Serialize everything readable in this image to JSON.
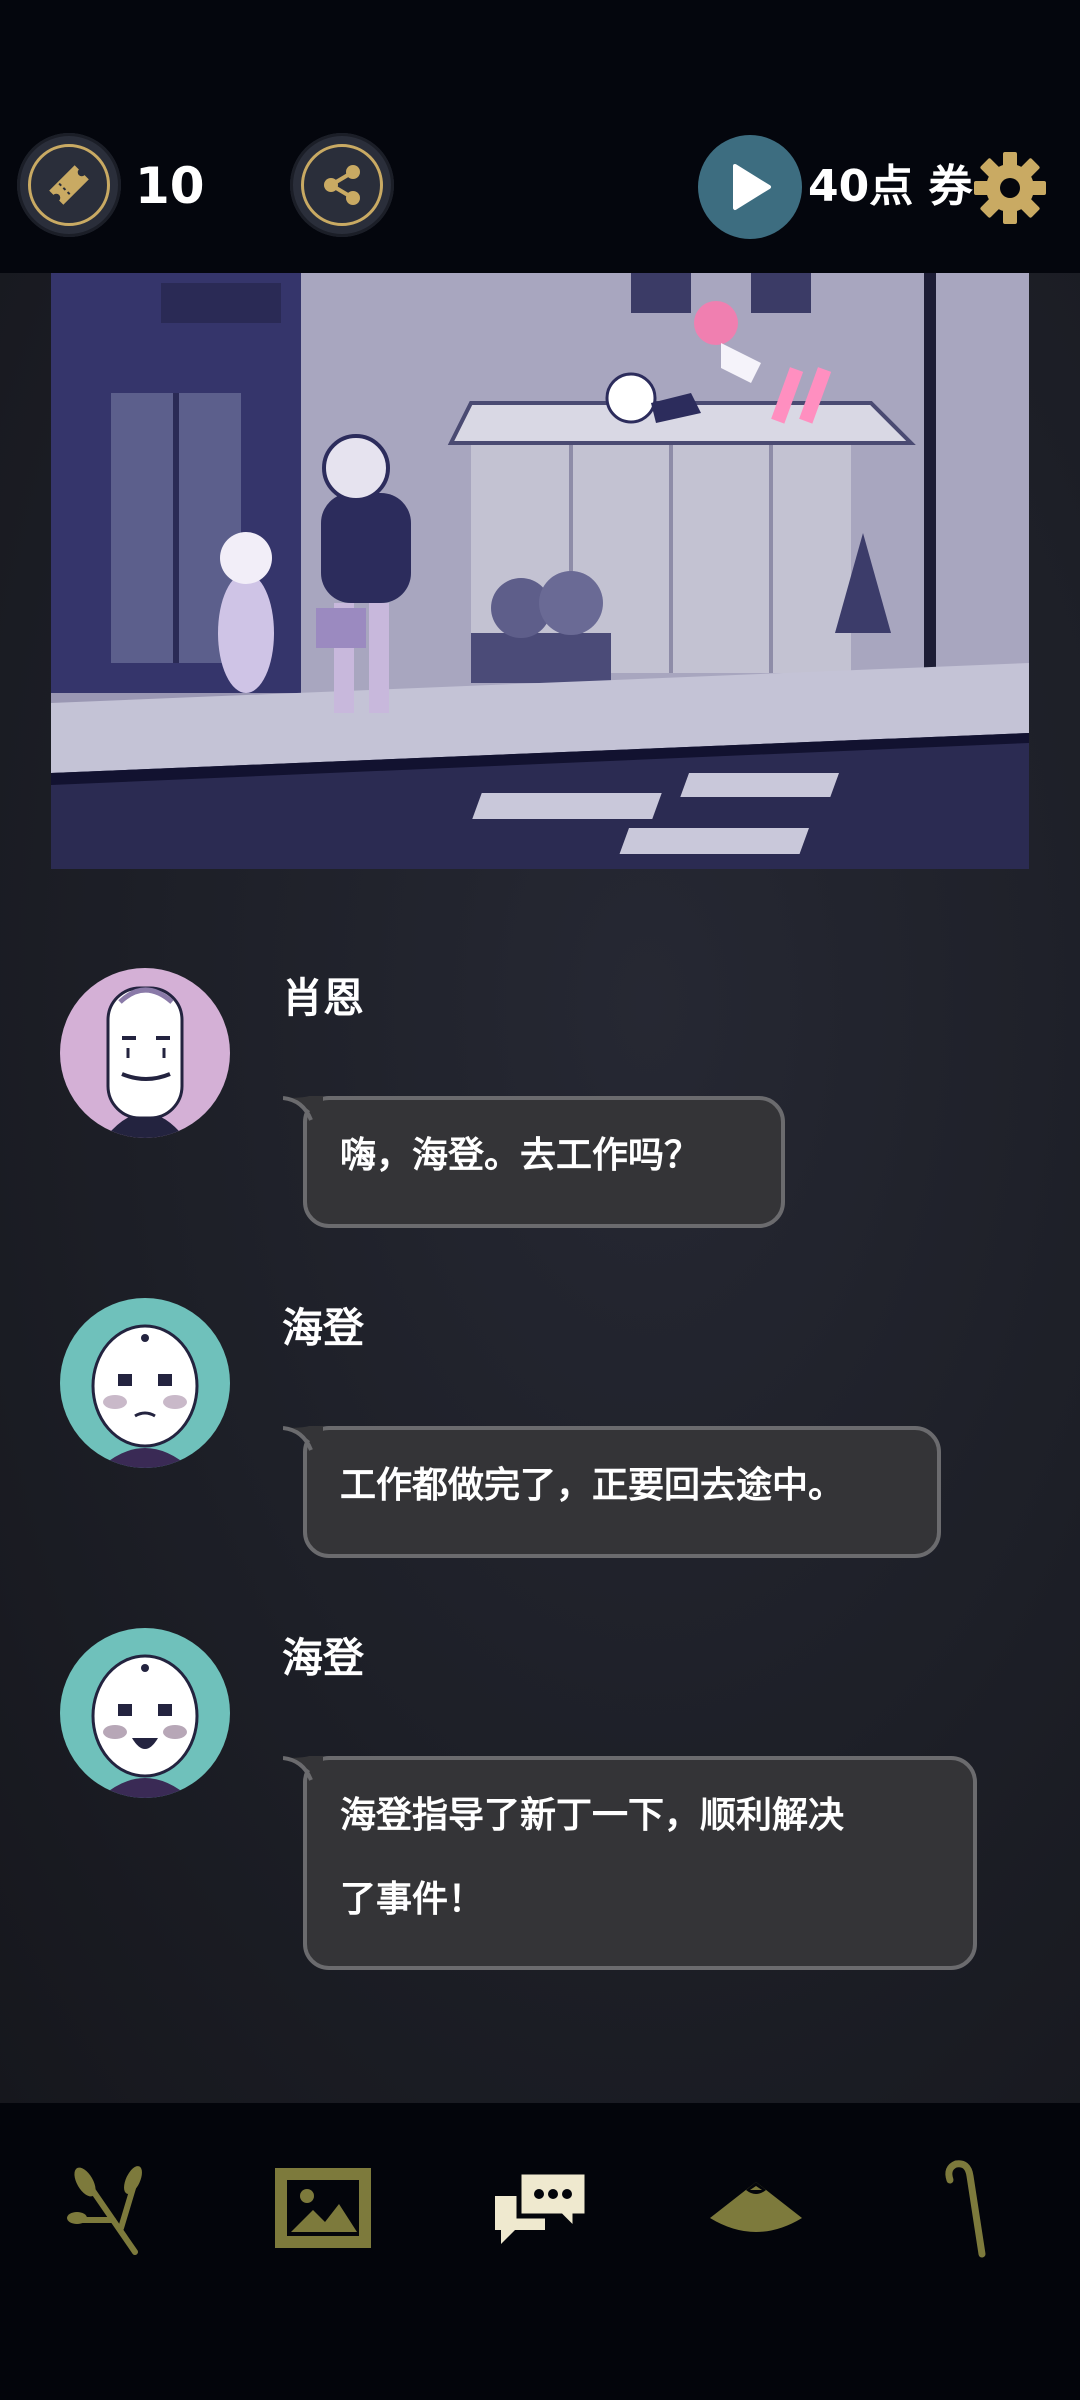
{
  "header": {
    "ticket_count": "10",
    "points_label": "40点 券"
  },
  "icons": {
    "ticket": "ticket-icon",
    "share": "share-icon",
    "play": "play-icon",
    "settings": "gear-icon"
  },
  "colors": {
    "gold": "#c9aa63",
    "olive": "#7d7a3c",
    "play_teal": "#3d6d80",
    "bubble_bg": "#343437",
    "bubble_border": "#6b6b6e"
  },
  "messages": [
    {
      "speaker": "肖恩",
      "lines": [
        "嗨，海登。去工作吗？"
      ],
      "avatar_color": "#d4b0d6"
    },
    {
      "speaker": "海登",
      "lines": [
        "工作都做完了，正要回去途中。"
      ],
      "avatar_color": "#6fc1bb"
    },
    {
      "speaker": "海登",
      "lines": [
        "海登指导了新丁一下，顺利解决",
        "了事件！"
      ],
      "avatar_color": "#6fc1bb"
    }
  ],
  "nav": [
    {
      "icon": "branch-icon",
      "active": false
    },
    {
      "icon": "gallery-icon",
      "active": false
    },
    {
      "icon": "chat-icon",
      "active": true
    },
    {
      "icon": "hat-icon",
      "active": false
    },
    {
      "icon": "cane-icon",
      "active": false
    }
  ]
}
